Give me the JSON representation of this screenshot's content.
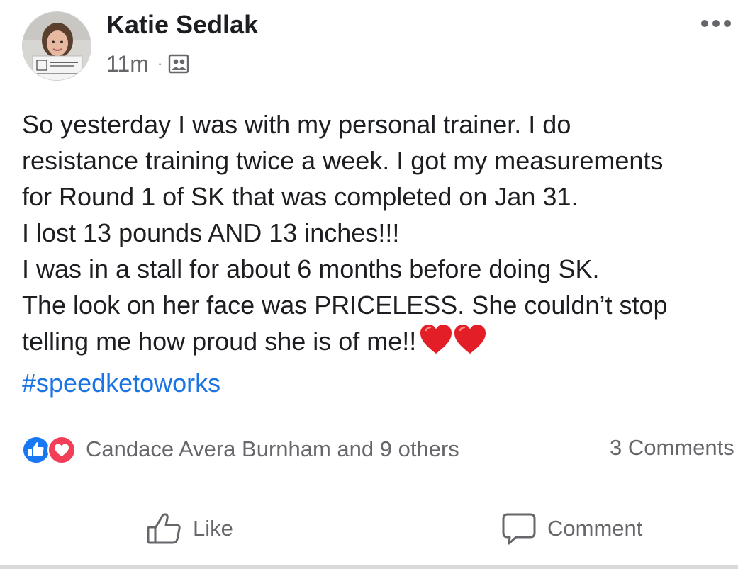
{
  "post": {
    "author": "Katie Sedlak",
    "time": "11m",
    "separator": "·",
    "audience_icon": "friends-audience-icon",
    "body_lines": [
      "So yesterday I was with my personal trainer. I do",
      "resistance training twice a week. I got my measurements",
      "for Round 1 of SK that was completed on Jan 31.",
      "I lost 13 pounds AND 13 inches!!!",
      "I was in a stall for about 6 months before doing SK.",
      "The look on her face was PRICELESS. She couldn’t stop",
      "telling me how proud she is of me!!"
    ],
    "hashtag": "#speedketoworks"
  },
  "reactions": {
    "icons": [
      "like-reaction-icon",
      "love-reaction-icon"
    ],
    "summary": "Candace Avera Burnham and 9 others",
    "comments": "3 Comments"
  },
  "actions": {
    "like_label": "Like",
    "comment_label": "Comment"
  },
  "colors": {
    "link": "#1b74e4",
    "secondary_text": "#65676b",
    "like_blue": "#1877f2",
    "love_red": "#f33e58",
    "heart_red": "#e41e26"
  }
}
